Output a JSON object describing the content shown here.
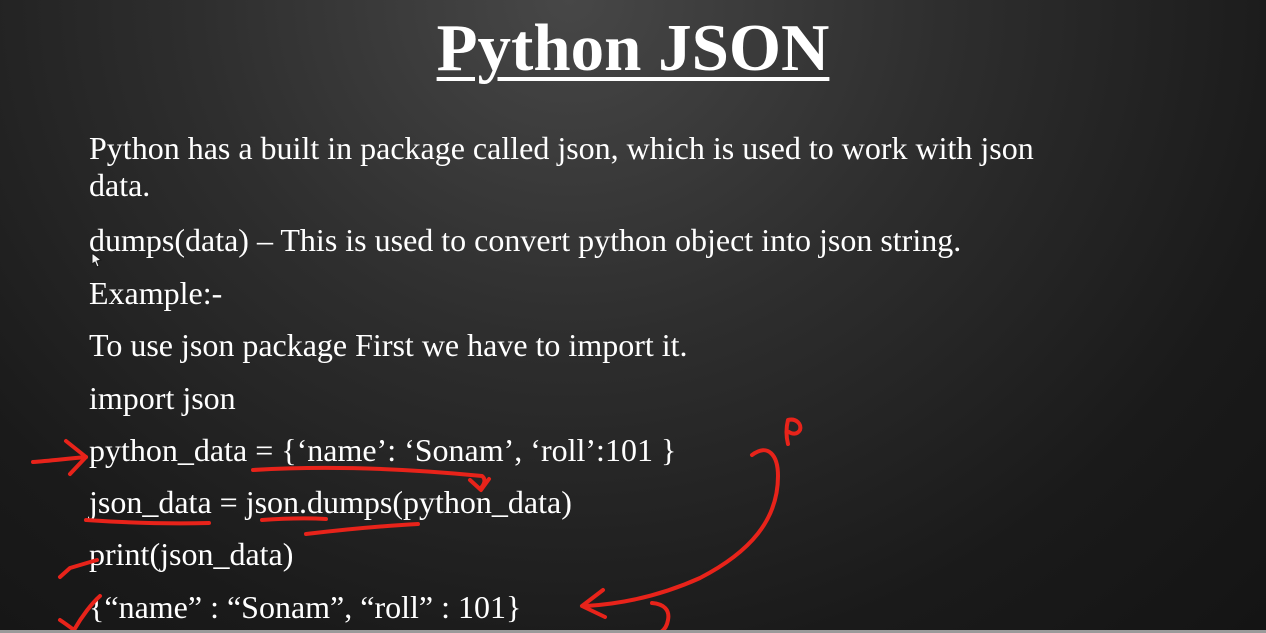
{
  "slide": {
    "title": "Python JSON",
    "lines": [
      "Python has a built in package called json, which is used to work with json",
      "data.",
      "dumps(data) – This is used to convert python object into json string.",
      "Example:-",
      "To use json package First we have to import it.",
      "import json",
      "python_data = {‘name’: ‘Sonam’, ‘roll’:101 }",
      "json_data = json.dumps(python_data)",
      "print(json_data)",
      "{“name” : “Sonam”, “roll” : 101}"
    ],
    "annotation_letter": "p",
    "annotation_color": "#e8231a"
  }
}
